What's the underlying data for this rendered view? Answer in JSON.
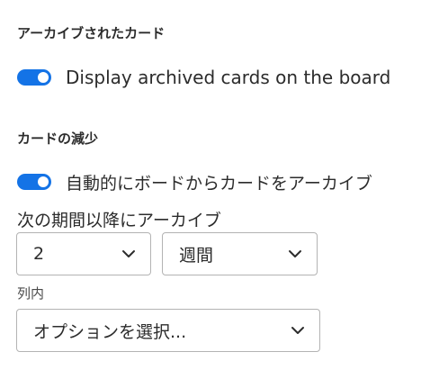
{
  "archived_section": {
    "heading": "アーカイブされたカード",
    "toggle_label": "Display archived cards on the board",
    "toggle_on": true
  },
  "reduction_section": {
    "heading": "カードの減少",
    "toggle_label": "自動的にボードからカードをアーカイブ",
    "toggle_on": true,
    "archive_after_label": "次の期間以降にアーカイブ",
    "count_select": {
      "value": "2"
    },
    "unit_select": {
      "value": "週間"
    },
    "column_label": "列内",
    "column_select": {
      "value": "オプションを選択..."
    }
  },
  "colors": {
    "accent": "#1473e6"
  }
}
